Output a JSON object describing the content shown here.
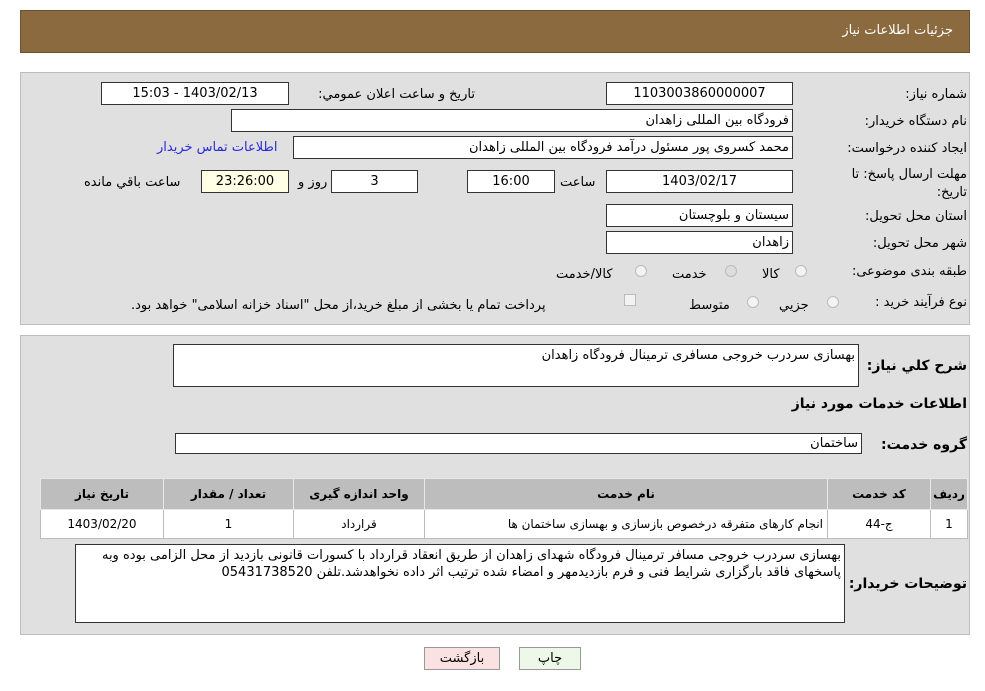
{
  "header": {
    "title": "جزئیات اطلاعات نیاز"
  },
  "form": {
    "need_number_label": "شماره نیاز:",
    "need_number": "1103003860000007",
    "announce_label": "تاریخ و ساعت اعلان عمومي:",
    "announce_value": "1403/02/13 - 15:03",
    "buyer_org_label": "نام دستگاه خریدار:",
    "buyer_org": "فرودگاه بین المللی زاهدان",
    "creator_label": "ایجاد کننده درخواست:",
    "creator": "محمد کسروی پور مسئول درآمد فرودگاه بین المللی زاهدان",
    "contact_link": "اطلاعات تماس خریدار",
    "deadline_label": "مهلت ارسال پاسخ: تا تاریخ:",
    "deadline_date": "1403/02/17",
    "time_label": "ساعت",
    "deadline_time": "16:00",
    "days": "3",
    "days_label": "روز و",
    "remaining": "23:26:00",
    "remaining_label": "ساعت باقي مانده",
    "province_label": "استان محل تحویل:",
    "province": "سیستان و بلوچستان",
    "city_label": "شهر محل تحویل:",
    "city": "زاهدان",
    "category_label": "طبقه بندی موضوعی:",
    "category_options": [
      "کالا",
      "خدمت",
      "کالا/خدمت"
    ],
    "category_selected": "خدمت",
    "process_label": "نوع فرآیند خرید :",
    "process_options": [
      "جزيي",
      "متوسط"
    ],
    "payment_note": "پرداخت تمام یا بخشی از مبلغ خرید،از محل \"اسناد خزانه اسلامی\" خواهد بود."
  },
  "details": {
    "summary_label": "شرح کلي نیاز:",
    "summary": "بهسازی سردرب خروجی مسافری ترمینال فرودگاه زاهدان",
    "services_title": "اطلاعات خدمات مورد نیاز",
    "group_label": "گروه خدمت:",
    "group": "ساختمان",
    "table": {
      "headers": [
        "ردیف",
        "کد خدمت",
        "نام خدمت",
        "واحد اندازه گیری",
        "تعداد / مقدار",
        "تاریخ نیاز"
      ],
      "rows": [
        [
          "1",
          "ج-44",
          "انجام کارهای متفرقه درخصوص بازسازی و بهسازی ساختمان ها",
          "قرارداد",
          "1",
          "1403/02/20"
        ]
      ]
    },
    "notes_label": "توضیحات خریدار:",
    "notes": "بهسازی سردرب خروجی مسافر ترمینال فرودگاه شهدای زاهدان  از طریق انعقاد قرارداد با کسورات قانونی بازدید از محل الزامی بوده وبه پاسخهای فاقد بارگزاری شرایط فنی و فرم بازدیدمهر و امضاء شده ترتیب اثر داده نخواهدشد.تلفن 05431738520"
  },
  "buttons": {
    "print": "چاپ",
    "back": "بازگشت"
  }
}
